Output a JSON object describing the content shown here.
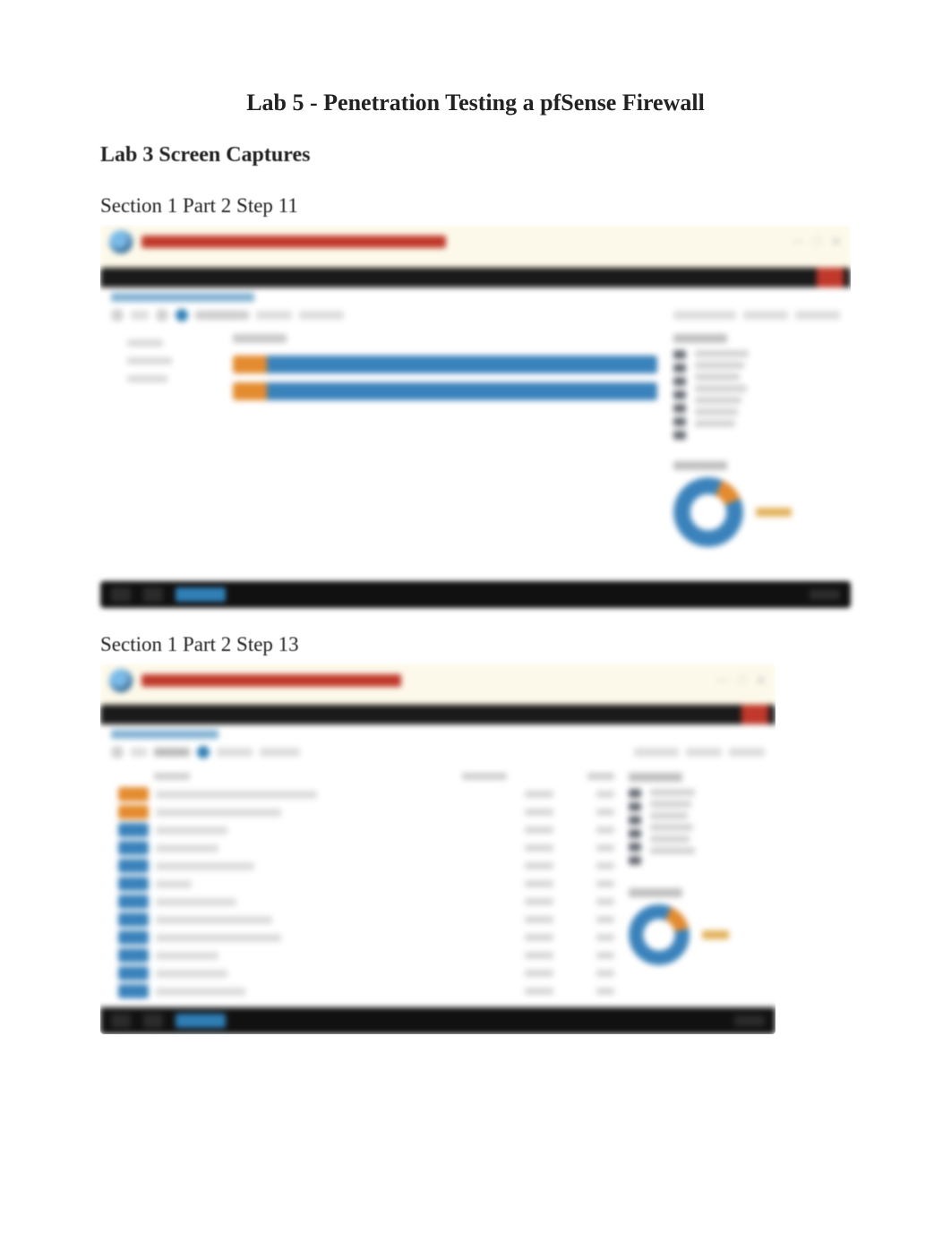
{
  "document": {
    "title": "Lab 5 - Penetration Testing a pfSense Firewall",
    "heading": "Lab 3 Screen Captures"
  },
  "captures": [
    {
      "caption": "Section 1 Part 2 Step 11",
      "window_controls": {
        "min": "—",
        "max": "□",
        "close": "✕"
      },
      "legend_title": "",
      "donut_title": "",
      "donut_label": ""
    },
    {
      "caption": "Section 1 Part 2 Step 13",
      "window_controls": {
        "min": "—",
        "max": "□",
        "close": "✕"
      },
      "legend_title": "",
      "donut_title": "",
      "donut_label": ""
    }
  ],
  "chart_data": [
    {
      "type": "bar",
      "orientation": "horizontal",
      "title": "",
      "series": [
        {
          "name": "High",
          "color": "#e48b2f",
          "values": [
            1,
            1
          ]
        },
        {
          "name": "Medium",
          "color": "#3a82bb",
          "values": [
            9,
            9
          ]
        }
      ],
      "categories": [
        "row1",
        "row2"
      ],
      "xlim": [
        0,
        10
      ]
    },
    {
      "type": "pie",
      "title": "",
      "series": [
        {
          "name": "Medium",
          "color": "#3a82bb",
          "value": 88
        },
        {
          "name": "High",
          "color": "#e48b2f",
          "value": 12
        }
      ]
    },
    {
      "type": "table",
      "title": "",
      "columns": [
        "Severity",
        "Name",
        "",
        ""
      ],
      "rows": [
        {
          "severity": "high",
          "name": ""
        },
        {
          "severity": "high",
          "name": ""
        },
        {
          "severity": "med",
          "name": ""
        },
        {
          "severity": "med",
          "name": ""
        },
        {
          "severity": "med",
          "name": ""
        },
        {
          "severity": "med",
          "name": ""
        },
        {
          "severity": "med",
          "name": ""
        },
        {
          "severity": "med",
          "name": ""
        },
        {
          "severity": "med",
          "name": ""
        },
        {
          "severity": "med",
          "name": ""
        },
        {
          "severity": "med",
          "name": ""
        },
        {
          "severity": "med",
          "name": ""
        }
      ]
    },
    {
      "type": "pie",
      "title": "",
      "series": [
        {
          "name": "Medium",
          "color": "#3a82bb",
          "value": 85
        },
        {
          "name": "High",
          "color": "#e48b2f",
          "value": 15
        }
      ]
    }
  ]
}
